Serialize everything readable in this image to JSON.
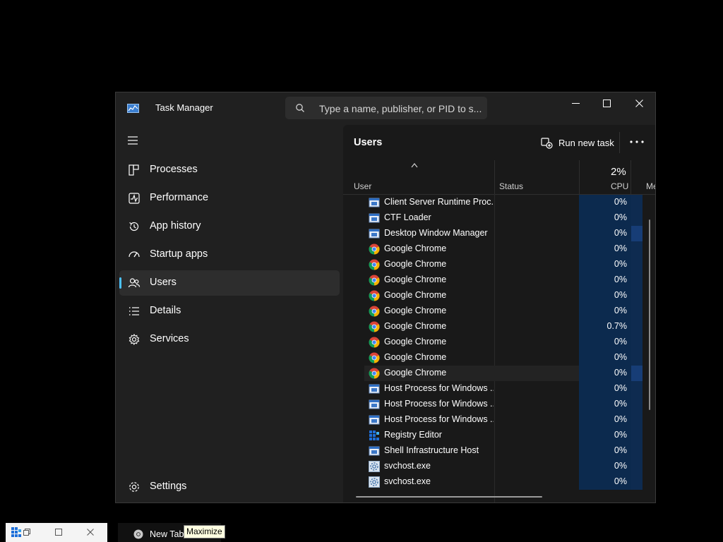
{
  "window": {
    "title": "Task Manager",
    "search_placeholder": "Type a name, publisher, or PID to s...",
    "icons": {
      "app": "task-manager-icon",
      "minimize": "minimize-icon",
      "maximize": "maximize-icon",
      "close": "close-icon"
    }
  },
  "nav": {
    "items": [
      {
        "label": "Processes",
        "icon": "processes-icon"
      },
      {
        "label": "Performance",
        "icon": "performance-icon"
      },
      {
        "label": "App history",
        "icon": "app-history-icon"
      },
      {
        "label": "Startup apps",
        "icon": "startup-apps-icon"
      },
      {
        "label": "Users",
        "icon": "users-icon",
        "active": true
      },
      {
        "label": "Details",
        "icon": "details-icon"
      },
      {
        "label": "Services",
        "icon": "services-icon"
      }
    ],
    "settings_label": "Settings"
  },
  "page": {
    "title": "Users",
    "run_new_task": "Run new task"
  },
  "columns": {
    "user": "User",
    "status": "Status",
    "cpu_total": "2%",
    "cpu": "CPU",
    "memory_partial": "Me"
  },
  "rows": [
    {
      "name": "Client Server Runtime Proc...",
      "icon": "system-process-icon",
      "cpu": "0%"
    },
    {
      "name": "CTF Loader",
      "icon": "system-process-icon",
      "cpu": "0%"
    },
    {
      "name": "Desktop Window Manager",
      "icon": "system-process-icon",
      "cpu": "0%",
      "mem_high": true
    },
    {
      "name": "Google Chrome",
      "icon": "chrome-icon",
      "cpu": "0%"
    },
    {
      "name": "Google Chrome",
      "icon": "chrome-icon",
      "cpu": "0%"
    },
    {
      "name": "Google Chrome",
      "icon": "chrome-icon",
      "cpu": "0%"
    },
    {
      "name": "Google Chrome",
      "icon": "chrome-icon",
      "cpu": "0%"
    },
    {
      "name": "Google Chrome",
      "icon": "chrome-icon",
      "cpu": "0%"
    },
    {
      "name": "Google Chrome",
      "icon": "chrome-icon",
      "cpu": "0.7%"
    },
    {
      "name": "Google Chrome",
      "icon": "chrome-icon",
      "cpu": "0%"
    },
    {
      "name": "Google Chrome",
      "icon": "chrome-icon",
      "cpu": "0%"
    },
    {
      "name": "Google Chrome",
      "icon": "chrome-icon",
      "cpu": "0%",
      "highlighted": true,
      "mem_high": true
    },
    {
      "name": "Host Process for Windows ...",
      "icon": "system-process-icon",
      "cpu": "0%"
    },
    {
      "name": "Host Process for Windows ...",
      "icon": "system-process-icon",
      "cpu": "0%"
    },
    {
      "name": "Host Process for Windows ...",
      "icon": "system-process-icon",
      "cpu": "0%"
    },
    {
      "name": "Registry Editor",
      "icon": "registry-editor-icon",
      "cpu": "0%"
    },
    {
      "name": "Shell Infrastructure Host",
      "icon": "system-process-icon",
      "cpu": "0%"
    },
    {
      "name": "svchost.exe",
      "icon": "svchost-icon",
      "cpu": "0%"
    },
    {
      "name": "svchost.exe",
      "icon": "svchost-icon",
      "cpu": "0%"
    }
  ],
  "taskbar": {
    "new_tab_label": "New Tab",
    "tooltip": "Maximize"
  },
  "colors": {
    "accent": "#4cc2ff",
    "cpu_cell": "#0c2a4e",
    "mem_cell_high": "#173d76"
  }
}
